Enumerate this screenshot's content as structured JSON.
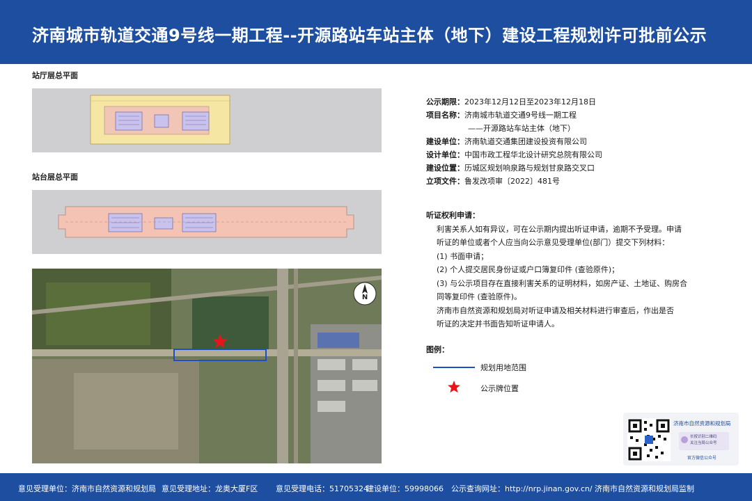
{
  "title": "济南城市轨道交通9号线一期工程--开源路站车站主体（地下）建设工程规划许可批前公示",
  "plans": {
    "concourse_label": "站厅层总平面",
    "platform_label": "站台层总平面"
  },
  "info": {
    "period_label": "公示期限：",
    "period_value": "2023年12月12日至2023年12月18日",
    "project_label": "项目名称：",
    "project_value_1": "济南城市轨道交通9号线一期工程",
    "project_value_2": "——开源路站车站主体（地下）",
    "builder_label": "建设单位：",
    "builder_value": "济南轨道交通集团建设投资有限公司",
    "designer_label": "设计单位：",
    "designer_value": "中国市政工程华北设计研究总院有限公司",
    "location_label": "建设位置：",
    "location_value": "历城区规划响泉路与规划甘泉路交叉口",
    "approval_label": "立项文件：",
    "approval_value": "鲁发改项审〔2022〕481号"
  },
  "hearing": {
    "title": "听证权利申请：",
    "line1": "利害关系人如有异议，可在公示期内提出听证申请，逾期不予受理。申请",
    "line2": "听证的单位或者个人应当向公示意见受理单位(部门）提交下列材料：",
    "item1": "(1) 书面申请；",
    "item2": "(2) 个人提交居民身份证或户口簿复印件 (查验原件)；",
    "item3a": "(3) 与公示项目存在直接利害关系的证明材料，如房产证、土地证、购房合",
    "item3b": "同等复印件 (查验原件)。",
    "line3": "济南市自然资源和规划局对听证申请及相关材料进行审查后，作出是否",
    "line4": "听证的决定并书面告知听证申请人。"
  },
  "legend": {
    "title": "图例：",
    "boundary_label": "规划用地范围",
    "sign_label": "公示牌位置",
    "boundary_color": "#1d4fc4",
    "star_color": "#e8141a"
  },
  "qr": {
    "org_name": "济南市自然资源和规划局",
    "badge_text_1": "长按识别二维码",
    "badge_text_2": "关注当局公众号",
    "caption": "官方微信公众号"
  },
  "map": {
    "north_label": "N"
  },
  "footer": {
    "dept": "意见受理单位：济南市自然资源和规划局",
    "address": "意见受理地址：龙奥大厦F区",
    "phone": "意见受理电话：51705324",
    "builder": "建设单位：59998066",
    "website": "公示查询网址：http://nrp.jinan.gov.cn/  济南市自然资源和规划局监制"
  },
  "colors": {
    "header_bg": "#1d4ea0",
    "concourse_fill": "#f5e6a4",
    "platform_fill": "#f4c3b3",
    "equipment_fill": "#c9c2ec"
  }
}
